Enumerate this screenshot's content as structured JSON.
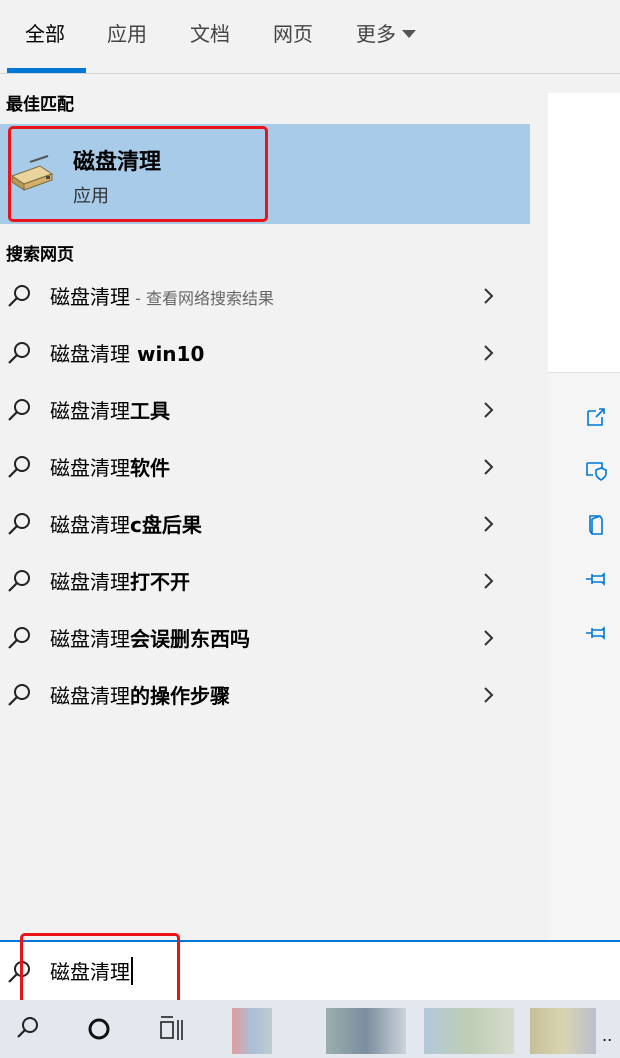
{
  "tabs": [
    {
      "label": "全部"
    },
    {
      "label": "应用"
    },
    {
      "label": "文档"
    },
    {
      "label": "网页"
    },
    {
      "label": "更多"
    }
  ],
  "best_match": {
    "header": "最佳匹配",
    "title": "磁盘清理",
    "subtitle": "应用",
    "icon": "disk-cleanup-icon"
  },
  "web_search": {
    "header": "搜索网页",
    "results": [
      {
        "query": "磁盘清理",
        "rest": "",
        "hint": " - 查看网络搜索结果"
      },
      {
        "query": "磁盘清理",
        "rest": " win10",
        "hint": ""
      },
      {
        "query": "磁盘清理",
        "rest": "工具",
        "hint": ""
      },
      {
        "query": "磁盘清理",
        "rest": "软件",
        "hint": ""
      },
      {
        "query": "磁盘清理",
        "rest": "c盘后果",
        "hint": ""
      },
      {
        "query": "磁盘清理",
        "rest": "打不开",
        "hint": ""
      },
      {
        "query": "磁盘清理",
        "rest": "会误删东西吗",
        "hint": ""
      },
      {
        "query": "磁盘清理",
        "rest": "的操作步骤",
        "hint": ""
      }
    ]
  },
  "right_actions": [
    "open-icon",
    "run-as-admin-icon",
    "open-file-location-icon",
    "pin-to-start-icon",
    "pin-to-taskbar-icon"
  ],
  "search": {
    "value": "磁盘清理"
  },
  "taskbar": {
    "icons": [
      "search-icon",
      "cortana-icon",
      "task-view-icon"
    ],
    "overflow": ".."
  },
  "colors": {
    "accent": "#0078d7",
    "selection": "#a7cbe9",
    "highlight": "#e8141a"
  }
}
